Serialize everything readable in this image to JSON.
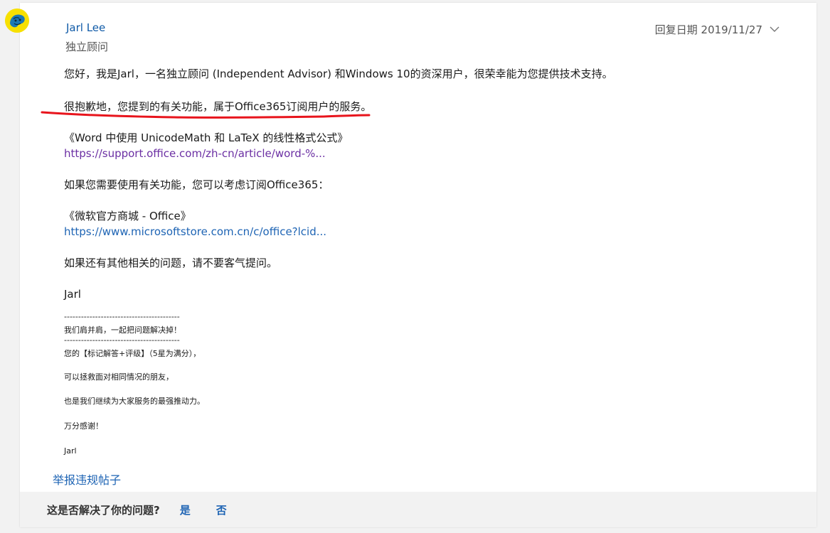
{
  "author": {
    "name": "Jarl Lee",
    "role": "独立顾问"
  },
  "reply": {
    "date_label": "回复日期 2019/11/27"
  },
  "body": {
    "p1": "您好，我是Jarl，一名独立顾问 (Independent Advisor) 和Windows 10的资深用户，很荣幸能为您提供技术支持。",
    "p2": "很抱歉地，您提到的有关功能，属于Office365订阅用户的服务。",
    "ref1_title": "《Word 中使用 UnicodeMath 和 LaTeX 的线性格式公式》",
    "ref1_url": "https://support.office.com/zh-cn/article/word-%...",
    "p3": "如果您需要使用有关功能，您可以考虑订阅Office365：",
    "ref2_title": "《微软官方商城 - Office》",
    "ref2_url": "https://www.microsoftstore.com.cn/c/office?lcid...",
    "p4": "如果还有其他相关的问题，请不要客气提问。",
    "sign": "Jarl"
  },
  "signature": {
    "divider": "-----------------------------------------",
    "motto": "我们肩并肩，一起把问题解决掉！",
    "line1": "您的【标记解答+评级】（5星为满分），",
    "line2": "可以拯救面对相同情况的朋友，",
    "line3": "也是我们继续为大家服务的最强推动力。",
    "line4": "万分感谢！",
    "name": "Jarl"
  },
  "actions": {
    "report": "举报违规帖子"
  },
  "footer": {
    "question": "这是否解决了你的问题?",
    "yes": "是",
    "no": "否"
  },
  "colors": {
    "link_blue": "#1e64b4",
    "link_visited": "#6b2fa3",
    "name_blue": "#0f5aa7",
    "highlight_red": "#e8141c",
    "avatar_yellow": "#f7e000"
  }
}
